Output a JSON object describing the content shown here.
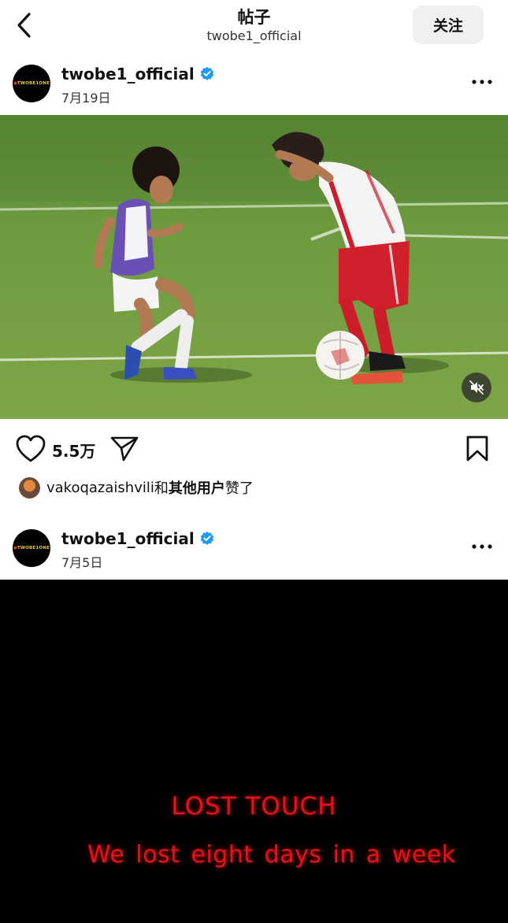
{
  "nav": {
    "title": "帖子",
    "subtitle": "twobe1_official",
    "follow_label": "关注"
  },
  "posts": [
    {
      "username": "twobe1_official",
      "date": "7月19日",
      "avatar_text": "TWOBE1ONE"
    },
    {
      "username": "twobe1_official",
      "date": "7月5日",
      "avatar_text": "TWOBE1ONE"
    }
  ],
  "actions": {
    "like_count": "5.5万"
  },
  "likers": {
    "name": "vakoqazaishvili",
    "connector": "和",
    "others": "其他用户",
    "suffix": "赞了"
  },
  "video": {
    "title": "LOST TOUCH",
    "caption": "We lost eight days in a week"
  },
  "colors": {
    "verified": "#1d9bf0",
    "video_text": "#e0141b"
  },
  "icons": [
    "back-arrow-icon",
    "verified-icon",
    "more-dots-icon",
    "mute-icon",
    "heart-icon",
    "send-icon",
    "bookmark-icon"
  ]
}
